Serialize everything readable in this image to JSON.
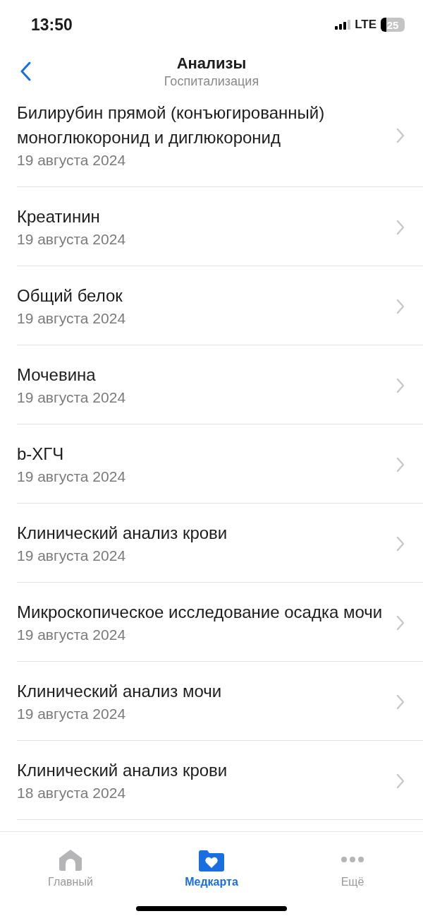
{
  "status_bar": {
    "time": "13:50",
    "network": "LTE",
    "battery": "25"
  },
  "header": {
    "title": "Анализы",
    "subtitle": "Госпитализация"
  },
  "items": [
    {
      "title": "Билирубин прямой (конъюгированный) моноглюкоронид и диглюкоронид",
      "date": "19 августа 2024"
    },
    {
      "title": "Креатинин",
      "date": "19 августа 2024"
    },
    {
      "title": "Общий белок",
      "date": "19 августа 2024"
    },
    {
      "title": "Мочевина",
      "date": "19 августа 2024"
    },
    {
      "title": "b-ХГЧ",
      "date": "19 августа 2024"
    },
    {
      "title": "Клинический анализ крови",
      "date": "19 августа 2024"
    },
    {
      "title": "Микроскопическое исследование осадка мочи",
      "date": "19 августа 2024"
    },
    {
      "title": "Клинический анализ мочи",
      "date": "19 августа 2024"
    },
    {
      "title": "Клинический анализ крови",
      "date": "18 августа 2024"
    }
  ],
  "tab_bar": [
    {
      "label": "Главный",
      "kind": "home",
      "selected": false
    },
    {
      "label": "Медкарта",
      "kind": "medcard",
      "selected": true
    },
    {
      "label": "Ещё",
      "kind": "more",
      "selected": false
    }
  ]
}
